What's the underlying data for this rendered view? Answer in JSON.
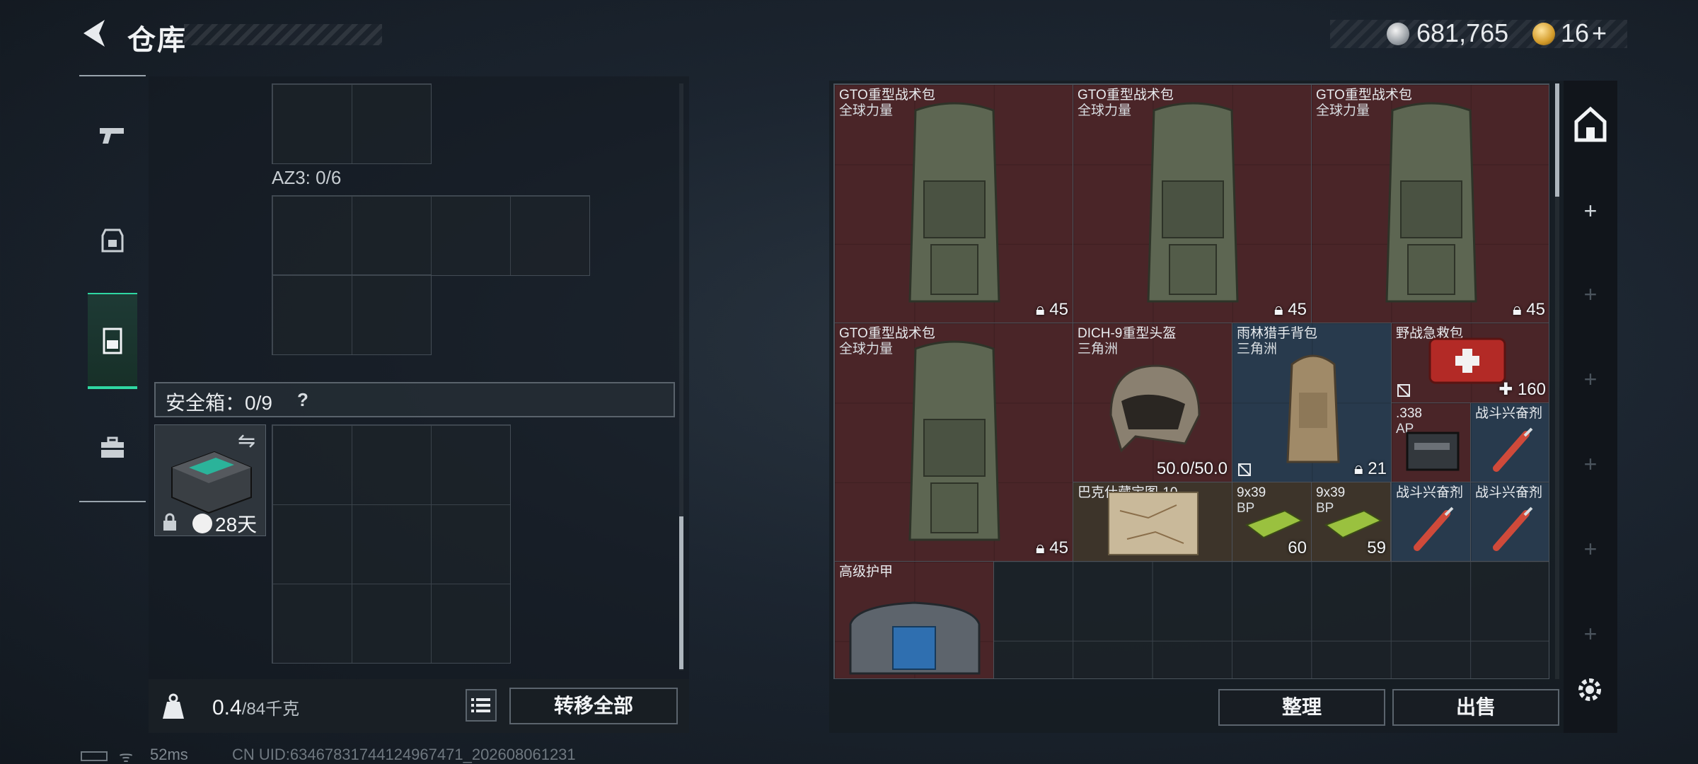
{
  "header": {
    "title": "仓库",
    "silver_amount": "681,765",
    "gold_amount": "16",
    "gold_plus": "+"
  },
  "left_nav": {
    "items": [
      {
        "icon": "pistol-icon",
        "active": false
      },
      {
        "icon": "backpack-icon",
        "active": false
      },
      {
        "icon": "container-icon",
        "active": true
      },
      {
        "icon": "toolbox-icon",
        "active": false
      }
    ]
  },
  "left_panel": {
    "az3_label": "AZ3: 0/6",
    "safe_label": "安全箱：0/9",
    "help": "?",
    "safebox_timer": "28天",
    "weight_value": "0.4",
    "weight_max": "/84千克",
    "transfer_all": "转移全部"
  },
  "stash": {
    "items": [
      {
        "name": "GTO重型战术包",
        "sub": "全球力量",
        "count": "45",
        "tier": "red",
        "icon": "backpack-icon"
      },
      {
        "name": "GTO重型战术包",
        "sub": "全球力量",
        "count": "45",
        "tier": "red",
        "icon": "backpack-icon"
      },
      {
        "name": "GTO重型战术包",
        "sub": "全球力量",
        "count": "45",
        "tier": "red",
        "icon": "backpack-icon"
      },
      {
        "name": "GTO重型战术包",
        "sub": "全球力量",
        "count": "45",
        "tier": "red",
        "icon": "backpack-icon"
      },
      {
        "name": "DICH-9重型头盔",
        "sub": "三角洲",
        "count": "50.0/50.0",
        "tier": "red",
        "icon": "helmet-icon"
      },
      {
        "name": "雨林猎手背包",
        "sub": "三角洲",
        "count": "21",
        "tier": "blue",
        "icon": "duffel-bag-icon"
      },
      {
        "name": "野战急救包",
        "sub": "",
        "count": "160",
        "tier": "red",
        "icon": "first-aid-kit-icon"
      },
      {
        "name": ".338",
        "sub": "AP",
        "count": "",
        "tier": "red",
        "icon": "ammo-box-icon"
      },
      {
        "name": "战斗兴奋剂",
        "sub": "",
        "count": "",
        "tier": "blue",
        "icon": "injector-icon"
      },
      {
        "name": "巴克什藏宝图-10",
        "sub": "",
        "count": "",
        "tier": "brown",
        "icon": "map-icon"
      },
      {
        "name": "9x39",
        "sub": "BP",
        "count": "60",
        "tier": "brown",
        "icon": "ammo-pack-icon"
      },
      {
        "name": "9x39",
        "sub": "BP",
        "count": "59",
        "tier": "brown",
        "icon": "ammo-pack-icon"
      },
      {
        "name": "战斗兴奋剂",
        "sub": "",
        "count": "",
        "tier": "blue",
        "icon": "injector-icon"
      },
      {
        "name": "战斗兴奋剂",
        "sub": "",
        "count": "",
        "tier": "blue",
        "icon": "injector-icon"
      },
      {
        "name": "高级护甲",
        "sub": "",
        "count": "",
        "tier": "red",
        "icon": "armor-vest-icon"
      }
    ],
    "sort_label": "整理",
    "sell_label": "出售"
  },
  "status_bar": {
    "ping": "52ms",
    "uid": "CN UID:634678317441249674​71_202608061231"
  }
}
